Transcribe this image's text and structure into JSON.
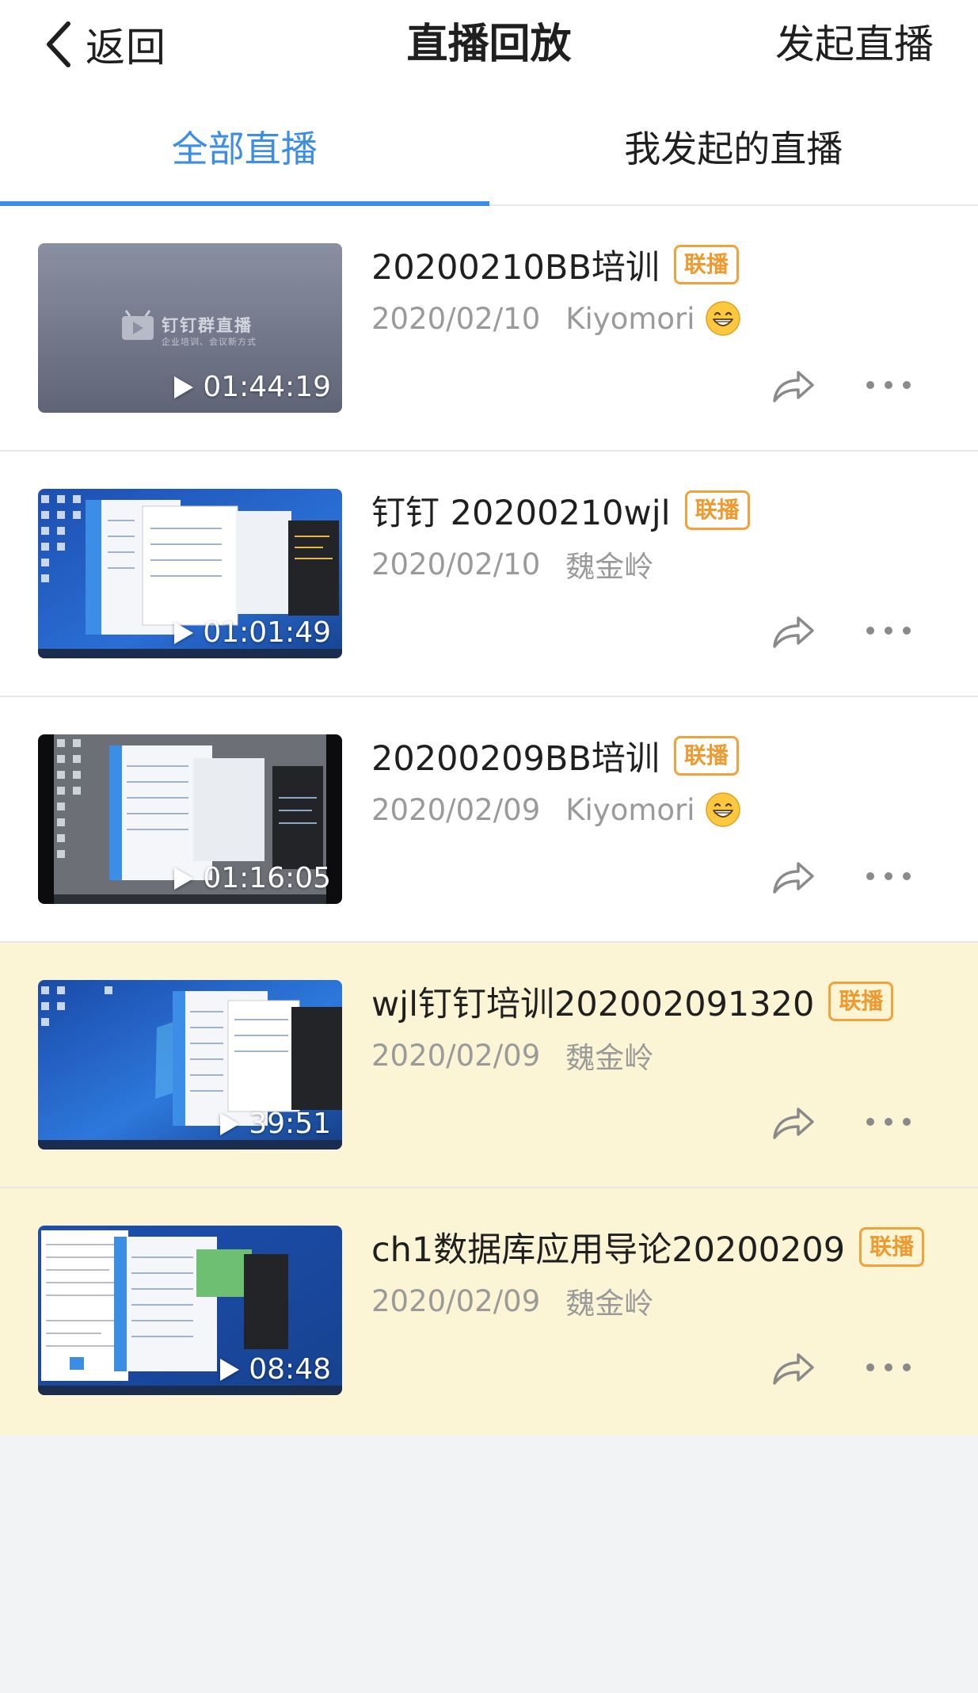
{
  "navbar": {
    "back_label": "返回",
    "title": "直播回放",
    "start_live_label": "发起直播"
  },
  "tabs": [
    {
      "label": "全部直播",
      "active": true
    },
    {
      "label": "我发起的直播",
      "active": false
    }
  ],
  "colors": {
    "accent": "#3b8de6",
    "tag": "#ef9a2e",
    "highlight_row": "#fbf5d6"
  },
  "replays": [
    {
      "title": "20200210BB培训",
      "tag": "联播",
      "date": "2020/02/10",
      "author": "Kiyomori",
      "author_emoji": "grinning-face-emoji",
      "duration": "01:44:19",
      "thumbnail": "dingtalk-group-live-placeholder",
      "thumbnail_brand": "钉钉群直播",
      "thumbnail_slogan": "企业培训、会议新方式",
      "highlighted": false
    },
    {
      "title": "钉钉 20200210wjl",
      "tag": "联播",
      "date": "2020/02/10",
      "author": "魏金岭",
      "duration": "01:01:49",
      "thumbnail": "desktop-screen-capture",
      "highlighted": false
    },
    {
      "title": "20200209BB培训",
      "tag": "联播",
      "date": "2020/02/09",
      "author": "Kiyomori",
      "author_emoji": "grinning-face-emoji",
      "duration": "01:16:05",
      "thumbnail": "desktop-screen-capture-dark",
      "highlighted": false
    },
    {
      "title": "wjl钉钉培训202002091320",
      "tag": "联播",
      "date": "2020/02/09",
      "author": "魏金岭",
      "duration": "39:51",
      "thumbnail": "desktop-screen-capture",
      "highlighted": true
    },
    {
      "title": "ch1数据库应用导论20200209",
      "tag": "联播",
      "date": "2020/02/09",
      "author": "魏金岭",
      "duration": "08:48",
      "thumbnail": "desktop-screen-capture-doc",
      "highlighted": true
    }
  ]
}
